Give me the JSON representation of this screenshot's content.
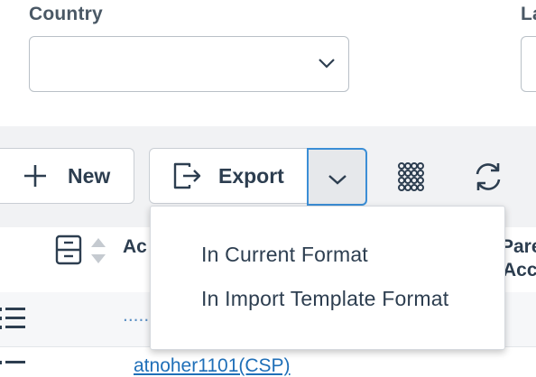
{
  "filters": {
    "country_label": "Country",
    "country_value": "",
    "next_label": "La"
  },
  "toolbar": {
    "new_label": "New",
    "export_label": "Export",
    "icons": [
      "plus-icon",
      "export-icon",
      "chevron-down-icon",
      "grid-icon",
      "refresh-icon"
    ]
  },
  "grid": {
    "columns": [
      "Ac",
      "Pare",
      "Acco"
    ],
    "rows": [
      {
        "account": "......"
      },
      {
        "account": "atnoher1101(CSP)"
      }
    ]
  },
  "export_menu": {
    "items": [
      "In Current Format",
      "In Import Template Format"
    ]
  },
  "colors": {
    "accent": "#3b8ed6",
    "text": "#2d3e50",
    "link": "#1f6fb8",
    "band": "#f1f2f4"
  }
}
